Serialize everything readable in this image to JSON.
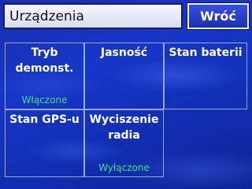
{
  "header": {
    "title": "Urządzenia",
    "back_label": "Wróć"
  },
  "tiles": [
    {
      "label": "Tryb\ndemonst.",
      "status": "Włączone"
    },
    {
      "label": "Jasność",
      "status": ""
    },
    {
      "label": "Stan baterii",
      "status": ""
    },
    {
      "label": "Stan GPS-u",
      "status": ""
    },
    {
      "label": "Wyciszenie\nradia",
      "status": "Wyłączone"
    }
  ],
  "colors": {
    "status_text": "#3fe07a",
    "background": "#1636c8"
  }
}
